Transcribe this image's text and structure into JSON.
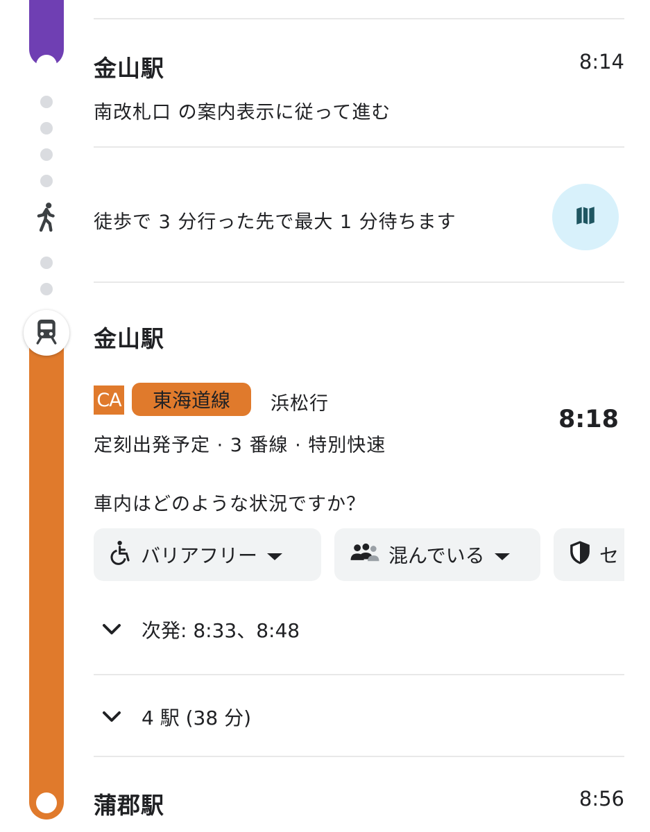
{
  "colors": {
    "purple_line": "#6f3fb3",
    "orange_line": "#e07a2c",
    "map_button_bg": "#d8f1fb",
    "walk_dot": "#dadce0"
  },
  "first_stop": {
    "station": "金山駅",
    "time": "8:14",
    "instruction": "南改札口 の案内表示に従って進む"
  },
  "walk": {
    "text": "徒歩で 3 分行った先で最大 1 分待ちます",
    "icon": "walking-person-icon",
    "map_icon": "map-icon"
  },
  "transit": {
    "station": "金山駅",
    "line_code": "CA",
    "line_name": "東海道線",
    "destination": "浜松行",
    "departure_time": "8:18",
    "details": "定刻出発予定 · 3 番線 · 特別快速",
    "crowd_question": "車内はどのような状況ですか？",
    "chips": [
      {
        "label": "バリアフリー",
        "icon": "wheelchair-icon"
      },
      {
        "label": "混んでいる",
        "icon": "people-icon"
      },
      {
        "label": "セ",
        "icon": "shield-icon"
      }
    ],
    "next_departures": "次発: 8:33、8:48",
    "stops_summary": "4 駅 (38 分)"
  },
  "arrival": {
    "station": "蒲郡駅",
    "time": "8:56"
  }
}
